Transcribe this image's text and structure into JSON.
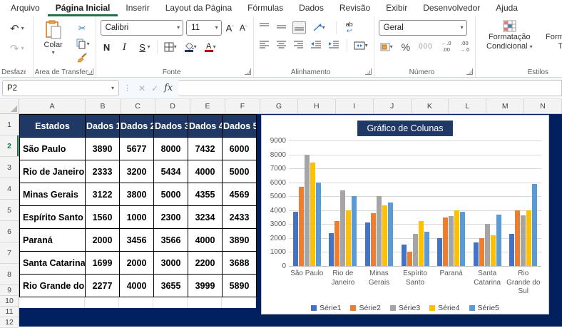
{
  "ribbon": {
    "tabs": [
      "Arquivo",
      "Página Inicial",
      "Inserir",
      "Layout da Página",
      "Fórmulas",
      "Dados",
      "Revisão",
      "Exibir",
      "Desenvolvedor",
      "Ajuda"
    ],
    "active_tab": "Página Inicial",
    "groups": {
      "undo": {
        "label": "Desfazer"
      },
      "clipboard": {
        "label": "Área de Transferên…",
        "paste_label": "Colar"
      },
      "font": {
        "label": "Fonte",
        "font_name": "Calibri",
        "font_size": "11",
        "bold": "N",
        "italic": "I",
        "underline": "S"
      },
      "alignment": {
        "label": "Alinhamento",
        "wrap_glyph": "ab"
      },
      "number": {
        "label": "Número",
        "format": "Geral",
        "percent": "%",
        "thousands": "000"
      },
      "styles": {
        "label": "Estilos",
        "conditional_line1": "Formatação",
        "conditional_line2": "Condicional",
        "table_line1": "Formatar como",
        "table_line2": "Tabela"
      }
    }
  },
  "formula_bar": {
    "name_box": "P2",
    "fx": "fx",
    "formula": ""
  },
  "grid": {
    "columns": [
      "A",
      "B",
      "C",
      "D",
      "E",
      "F",
      "G",
      "H",
      "I",
      "J",
      "K",
      "L",
      "M",
      "N"
    ],
    "rows": [
      "1",
      "2",
      "3",
      "4",
      "5",
      "6",
      "7",
      "8",
      "9",
      "10",
      "11",
      "12"
    ],
    "selected_row": "2"
  },
  "table": {
    "headers": [
      "Estados",
      "Dados 1",
      "Dados 2",
      "Dados 3",
      "Dados 4",
      "Dados 5"
    ],
    "rows": [
      [
        "São Paulo",
        "3890",
        "5677",
        "8000",
        "7432",
        "6000"
      ],
      [
        "Rio de Janeiro",
        "2333",
        "3200",
        "5434",
        "4000",
        "5000"
      ],
      [
        "Minas Gerais",
        "3122",
        "3800",
        "5000",
        "4355",
        "4569"
      ],
      [
        "Espírito Santo",
        "1560",
        "1000",
        "2300",
        "3234",
        "2433"
      ],
      [
        "Paraná",
        "2000",
        "3456",
        "3566",
        "4000",
        "3890"
      ],
      [
        "Santa Catarina",
        "1699",
        "2000",
        "3000",
        "2200",
        "3688"
      ],
      [
        "Rio Grande do Sul",
        "2277",
        "4000",
        "3655",
        "3999",
        "5890"
      ]
    ]
  },
  "chart_data": {
    "type": "bar",
    "title": "Gráfico de Colunas",
    "categories": [
      "São Paulo",
      "Rio de Janeiro",
      "Minas Gerais",
      "Espírito Santo",
      "Paraná",
      "Santa Catarina",
      "Rio Grande do Sul"
    ],
    "series": [
      {
        "name": "Série1",
        "color": "#4472C4",
        "values": [
          3890,
          2333,
          3122,
          1560,
          2000,
          1699,
          2277
        ]
      },
      {
        "name": "Série2",
        "color": "#ED7D31",
        "values": [
          5677,
          3200,
          3800,
          1000,
          3456,
          2000,
          4000
        ]
      },
      {
        "name": "Série3",
        "color": "#A5A5A5",
        "values": [
          8000,
          5434,
          5000,
          2300,
          3566,
          3000,
          3655
        ]
      },
      {
        "name": "Série4",
        "color": "#FFC000",
        "values": [
          7432,
          4000,
          4355,
          3234,
          4000,
          2200,
          3999
        ]
      },
      {
        "name": "Série5",
        "color": "#5B9BD5",
        "values": [
          6000,
          5000,
          4569,
          2433,
          3890,
          3688,
          5890
        ]
      }
    ],
    "ylim": [
      0,
      9000
    ],
    "ytick_step": 1000,
    "grid": true,
    "legend_position": "bottom"
  },
  "colors": {
    "sheet_fill": "#002060",
    "table_header": "#1F3864",
    "chart_title_bg": "#1F3864",
    "active_tab_accent": "#217346",
    "selection_accent": "#107C41"
  }
}
